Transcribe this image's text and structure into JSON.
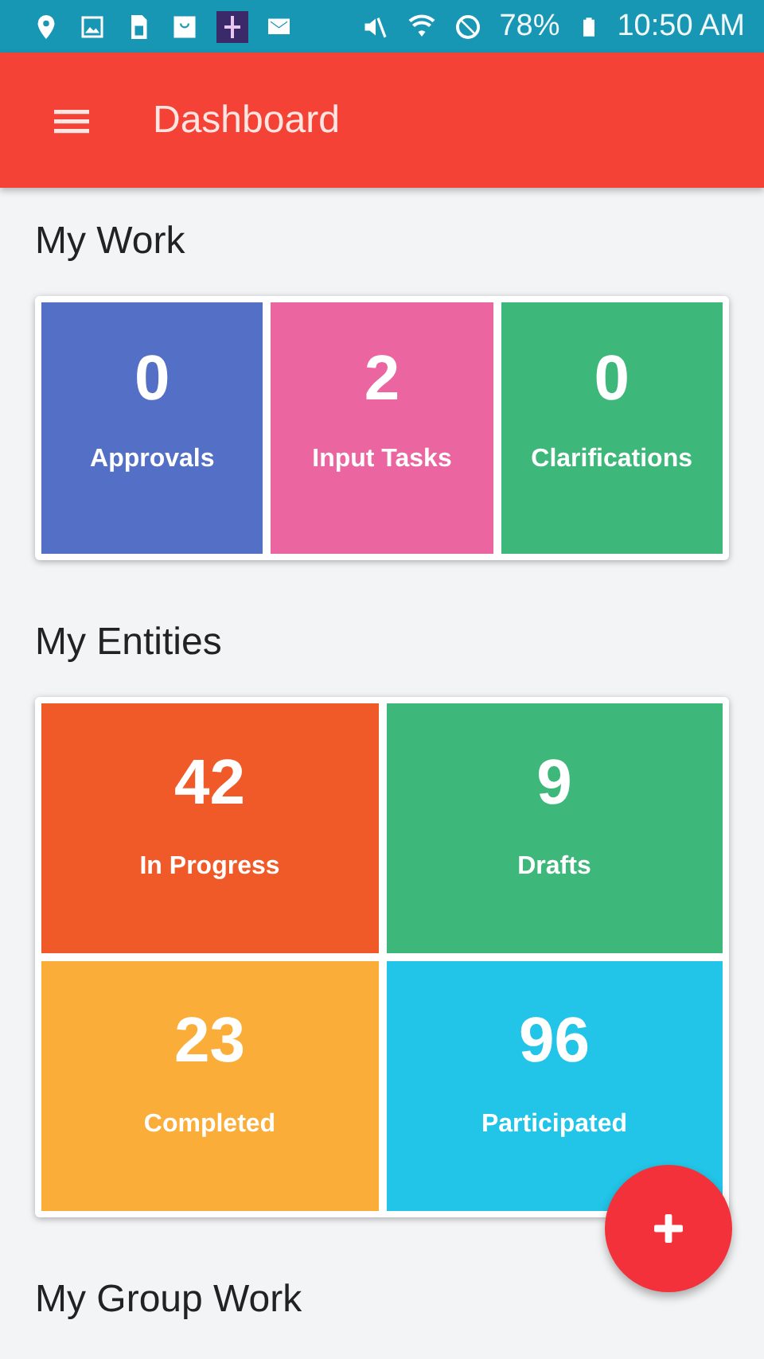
{
  "status_bar": {
    "battery": "78%",
    "time": "10:50 AM"
  },
  "app_bar": {
    "title": "Dashboard"
  },
  "sections": [
    {
      "title": "My Work",
      "tiles": [
        {
          "count": "0",
          "label": "Approvals",
          "color": "#5470c6"
        },
        {
          "count": "2",
          "label": "Input Tasks",
          "color": "#eb65a0"
        },
        {
          "count": "0",
          "label": "Clarifications",
          "color": "#3eb87a"
        }
      ]
    },
    {
      "title": "My Entities",
      "tiles": [
        {
          "count": "42",
          "label": "In Progress",
          "color": "#f05a28"
        },
        {
          "count": "9",
          "label": "Drafts",
          "color": "#3eb87a"
        },
        {
          "count": "23",
          "label": "Completed",
          "color": "#fbad3a"
        },
        {
          "count": "96",
          "label": "Participated",
          "color": "#22c4e8"
        }
      ]
    },
    {
      "title": "My Group Work"
    }
  ]
}
